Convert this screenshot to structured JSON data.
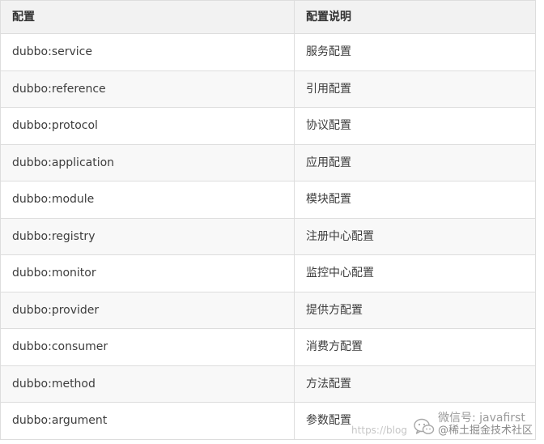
{
  "table": {
    "headers": {
      "name": "配置",
      "description": "配置说明"
    },
    "rows": [
      {
        "name": "dubbo:service",
        "description": "服务配置"
      },
      {
        "name": "dubbo:reference",
        "description": "引用配置"
      },
      {
        "name": "dubbo:protocol",
        "description": "协议配置"
      },
      {
        "name": "dubbo:application",
        "description": "应用配置"
      },
      {
        "name": "dubbo:module",
        "description": "模块配置"
      },
      {
        "name": "dubbo:registry",
        "description": "注册中心配置"
      },
      {
        "name": "dubbo:monitor",
        "description": "监控中心配置"
      },
      {
        "name": "dubbo:provider",
        "description": "提供方配置"
      },
      {
        "name": "dubbo:consumer",
        "description": "消费方配置"
      },
      {
        "name": "dubbo:method",
        "description": "方法配置"
      },
      {
        "name": "dubbo:argument",
        "description": "参数配置"
      }
    ]
  },
  "watermark": {
    "url": "https://blog",
    "wechat": "微信号: javafirst",
    "community": "@稀土掘金技术社区",
    "icon": "wechat-icon"
  },
  "colors": {
    "border": "#dddddd",
    "header_bg": "#f2f2f2",
    "stripe_bg": "#f8f8f8",
    "text": "#333333"
  }
}
